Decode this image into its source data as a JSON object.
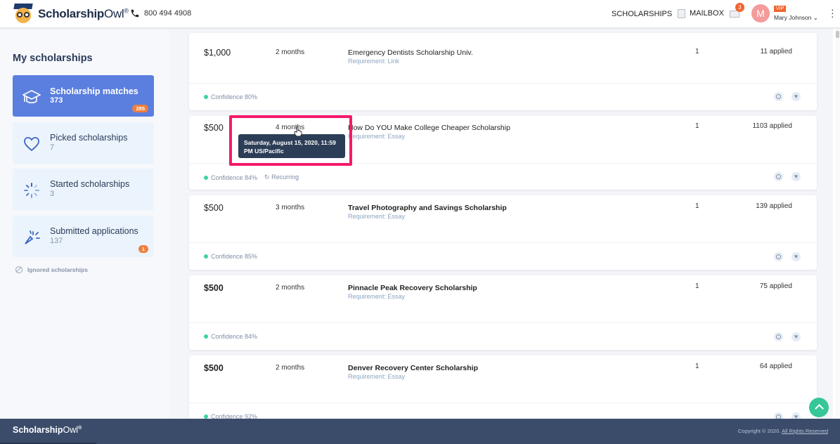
{
  "header": {
    "brand_bold": "Scholarship",
    "brand_light": "Owl",
    "brand_mark": "®",
    "phone": "800 494 4908",
    "nav_scholarships": "SCHOLARSHIPS",
    "nav_mailbox": "MAILBOX",
    "mail_badge": "3",
    "avatar_initial": "M",
    "vip": "VIP",
    "user_name": "Mary Johnson ⌄"
  },
  "sidebar": {
    "title": "My scholarships",
    "items": [
      {
        "label": "Scholarship matches",
        "count": "373",
        "badge": "285",
        "icon": "graduation-cap-icon"
      },
      {
        "label": "Picked scholarships",
        "count": "7",
        "icon": "heart-icon"
      },
      {
        "label": "Started scholarships",
        "count": "3",
        "icon": "spinner-icon"
      },
      {
        "label": "Submitted applications",
        "count": "137",
        "badge": "1",
        "icon": "sparkle-submit-icon"
      }
    ],
    "ignored": "Ignored scholarships"
  },
  "scholarships": [
    {
      "amount": "$1,000",
      "deadline": "2 months",
      "name": "Emergency Dentists Scholarship Univ.",
      "requirement": "Requirement: Link",
      "qty": "1",
      "applied": "11 applied",
      "confidence": "Confidence 80%"
    },
    {
      "amount": "$500",
      "deadline": "4 months",
      "name": "How Do YOU Make College Cheaper Scholarship",
      "requirement": "Requirement: Essay",
      "qty": "1",
      "applied": "1103 applied",
      "confidence": "Confidence 84%",
      "recurring": "↻ Recurring"
    },
    {
      "amount": "$500",
      "deadline": "3 months",
      "name": "Travel Photography and Savings Scholarship",
      "requirement": "Requirement: Essay",
      "qty": "1",
      "applied": "139 applied",
      "confidence": "Confidence 85%"
    },
    {
      "amount": "$500",
      "deadline": "2 months",
      "name": "Pinnacle Peak Recovery Scholarship",
      "requirement": "Requirement: Essay",
      "qty": "1",
      "applied": "75 applied",
      "confidence": "Confidence 84%"
    },
    {
      "amount": "$500",
      "deadline": "2 months",
      "name": "Denver Recovery Center Scholarship",
      "requirement": "Requirement: Essay",
      "qty": "1",
      "applied": "64 applied",
      "confidence": "Confidence 92%"
    }
  ],
  "tooltip": {
    "line1": "Saturday, August 15, 2020, 11:59",
    "line2": "PM US/Pacific"
  },
  "footer": {
    "brand_bold": "Scholarship",
    "brand_light": "Owl",
    "brand_mark": "®",
    "copyright": "Copyright © 2020.",
    "rights": "All Rights Reserved"
  },
  "colors": {
    "accent": "#5b7fdf",
    "footer": "#3b4c6b",
    "badge": "#f07f3c",
    "highlight": "#f51a6a",
    "confidence_dot": "#3fd2a1"
  }
}
